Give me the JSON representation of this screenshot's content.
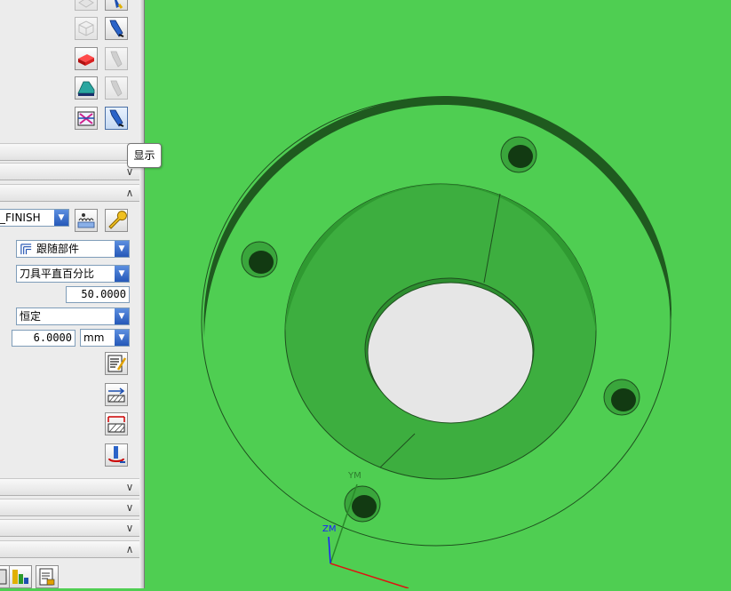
{
  "window": {
    "viewport_bg": "#4fce52",
    "part_color": "#39a83a"
  },
  "tooltip": {
    "text": "显示"
  },
  "operation": {
    "method_value": "_FINISH",
    "cut_pattern_value": "跟随部件",
    "stepover_value": "刀具平直百分比",
    "percent_value": "50.0000",
    "depth_type_value": "恒定",
    "depth_value": "6.0000",
    "unit_value": "mm"
  },
  "sections": {
    "collapsed_chevron": "∨",
    "expanded_chevron": "∧"
  },
  "axes": {
    "y_label": "YM",
    "z_label": "ZM"
  },
  "icons": {
    "toolbar_rows": [
      "wireframe-icon",
      "flashlight-icon",
      "red-block-icon",
      "gray-flashlight-icon",
      "green-wedge-icon",
      "display-check-icon"
    ],
    "op_tools": [
      "edit-params-icon",
      "stepover-icon",
      "cut-levels-icon",
      "cutter-motion-icon"
    ],
    "bottom": [
      "tool-icon",
      "geometry-icon",
      "report-icon"
    ]
  }
}
